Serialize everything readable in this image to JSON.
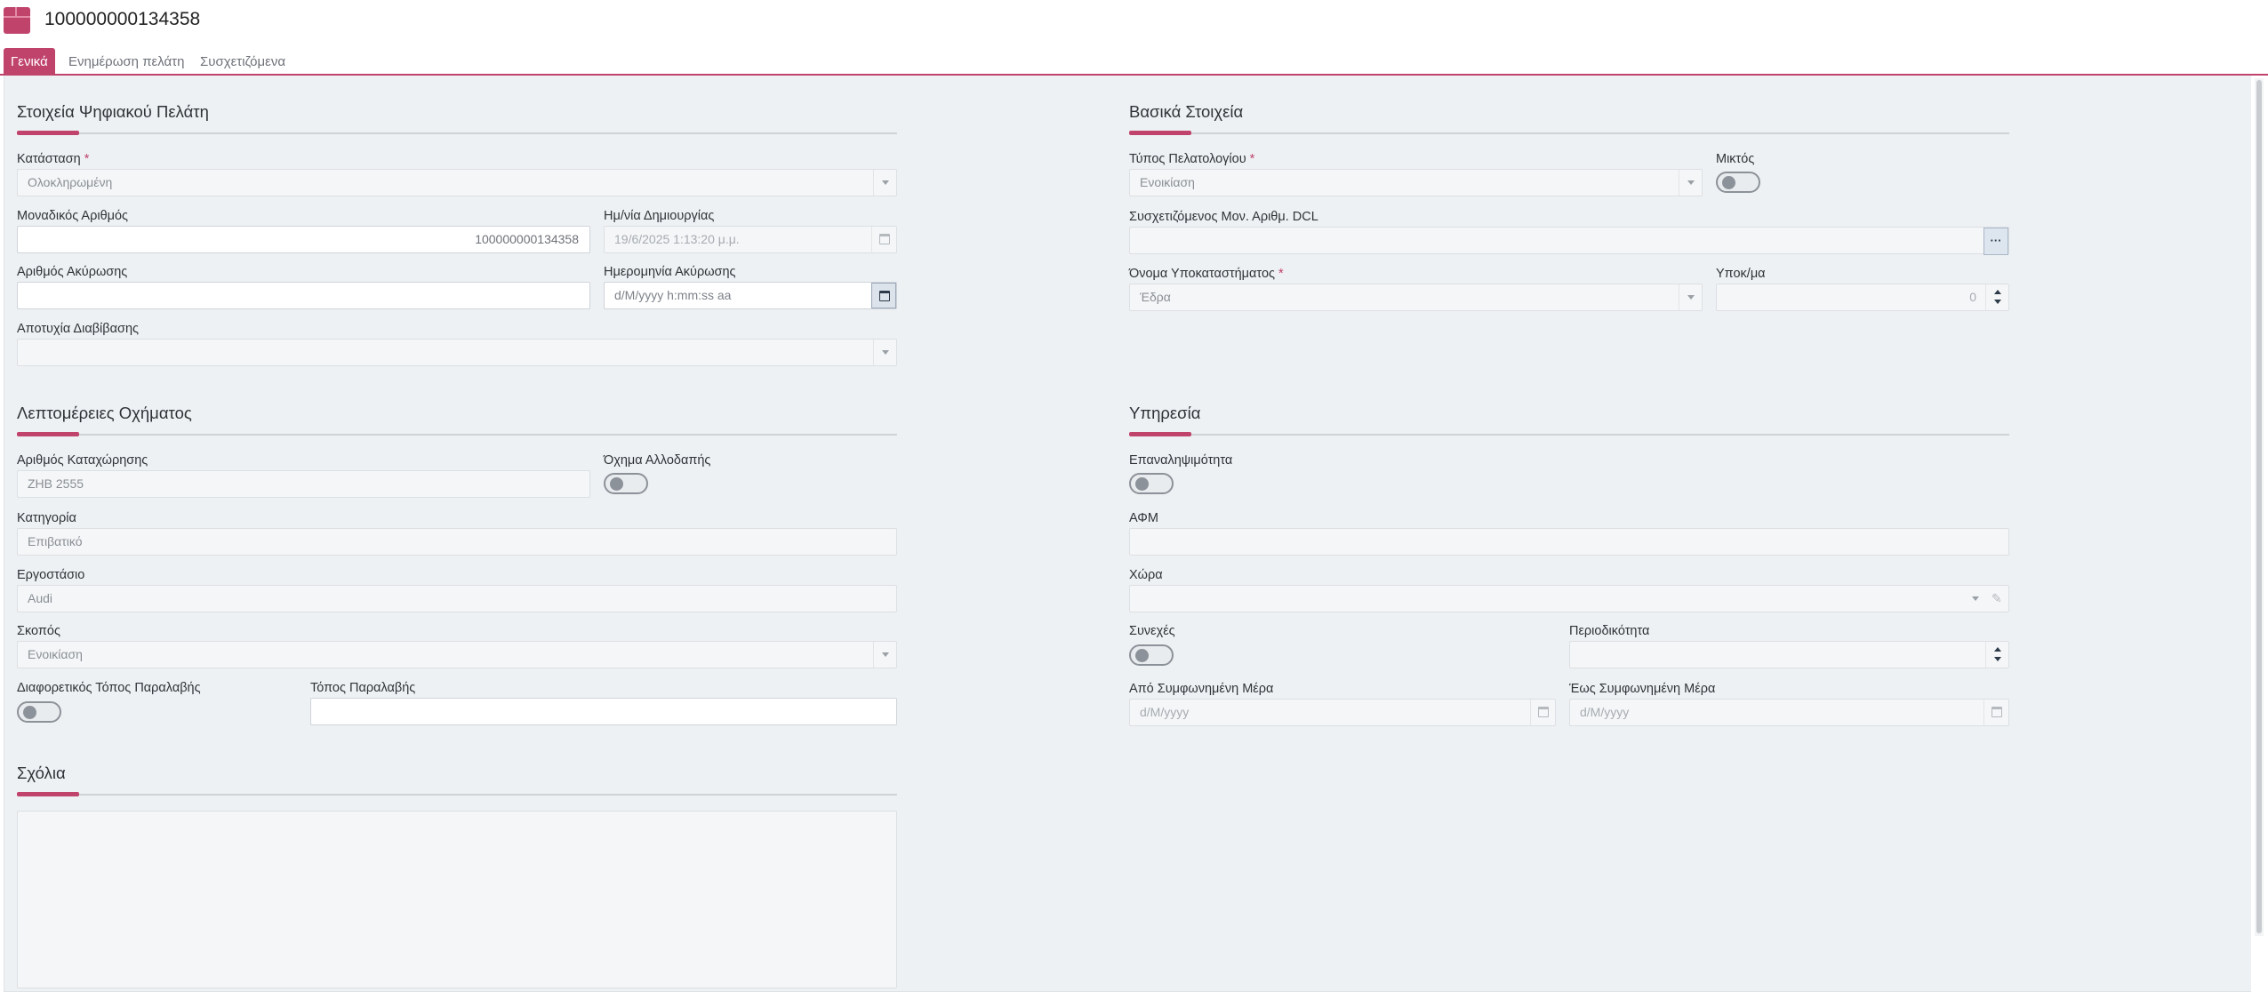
{
  "header": {
    "title": "100000000134358"
  },
  "tabs": [
    {
      "label": "Γενικά"
    },
    {
      "label": "Ενημέρωση πελάτη"
    },
    {
      "label": "Συσχετιζόμενα"
    }
  ],
  "sections": {
    "digital_customer": {
      "title": "Στοιχεία Ψηφιακού Πελάτη",
      "status_label": "Κατάσταση",
      "status_value": "Ολοκληρωμένη",
      "unique_number_label": "Μοναδικός Αριθμός",
      "unique_number_value": "100000000134358",
      "creation_date_label": "Ημ/νία Δημιουργίας",
      "creation_date_value": "19/6/2025 1:13:20 μ.μ.",
      "cancel_number_label": "Αριθμός Ακύρωσης",
      "cancel_number_value": "",
      "cancel_date_label": "Ημερομηνία Ακύρωσης",
      "cancel_date_placeholder": "d/M/yyyy h:mm:ss aa",
      "transmission_failure_label": "Αποτυχία Διαβίβασης",
      "transmission_failure_value": ""
    },
    "basic": {
      "title": "Βασικά Στοιχεία",
      "customer_type_label": "Τύπος Πελατολογίου",
      "customer_type_value": "Ενοικίαση",
      "mixed_label": "Μικτός",
      "related_dcl_label": "Συσχετιζόμενος Μον. Αριθμ. DCL",
      "related_dcl_value": "",
      "dots_label": "···",
      "branch_name_label": "Όνομα Υποκαταστήματος",
      "branch_name_value": "Έδρα",
      "branch_no_label": "Υποκ/μα",
      "branch_no_value": "0"
    },
    "vehicle": {
      "title": "Λεπτομέρειες Οχήματος",
      "plate_label": "Αριθμός Καταχώρησης",
      "plate_value": "ΖΗΒ 2555",
      "foreign_label": "Όχημα Αλλοδαπής",
      "category_label": "Κατηγορία",
      "category_value": "Επιβατικό",
      "manufacturer_label": "Εργοστάσιο",
      "manufacturer_value": "Audi",
      "purpose_label": "Σκοπός",
      "purpose_value": "Ενοικίαση",
      "diff_pickup_label": "Διαφορετικός Τόπος Παραλαβής",
      "pickup_place_label": "Τόπος Παραλαβής",
      "pickup_place_value": ""
    },
    "service": {
      "title": "Υπηρεσία",
      "repeatability_label": "Επαναληψιμότητα",
      "afm_label": "ΑΦΜ",
      "afm_value": "",
      "country_label": "Χώρα",
      "country_value": "",
      "continuous_label": "Συνεχές",
      "periodicity_label": "Περιοδικότητα",
      "periodicity_value": "",
      "from_day_label": "Από Συμφωνημένη Μέρα",
      "from_day_placeholder": "d/M/yyyy",
      "to_day_label": "Έως Συμφωνημένη Μέρα",
      "to_day_placeholder": "d/M/yyyy"
    },
    "comments": {
      "title": "Σχόλια",
      "value": ""
    }
  },
  "required_marker": "*",
  "colors": {
    "accent": "#c0436c",
    "background": "#eef1f3"
  }
}
